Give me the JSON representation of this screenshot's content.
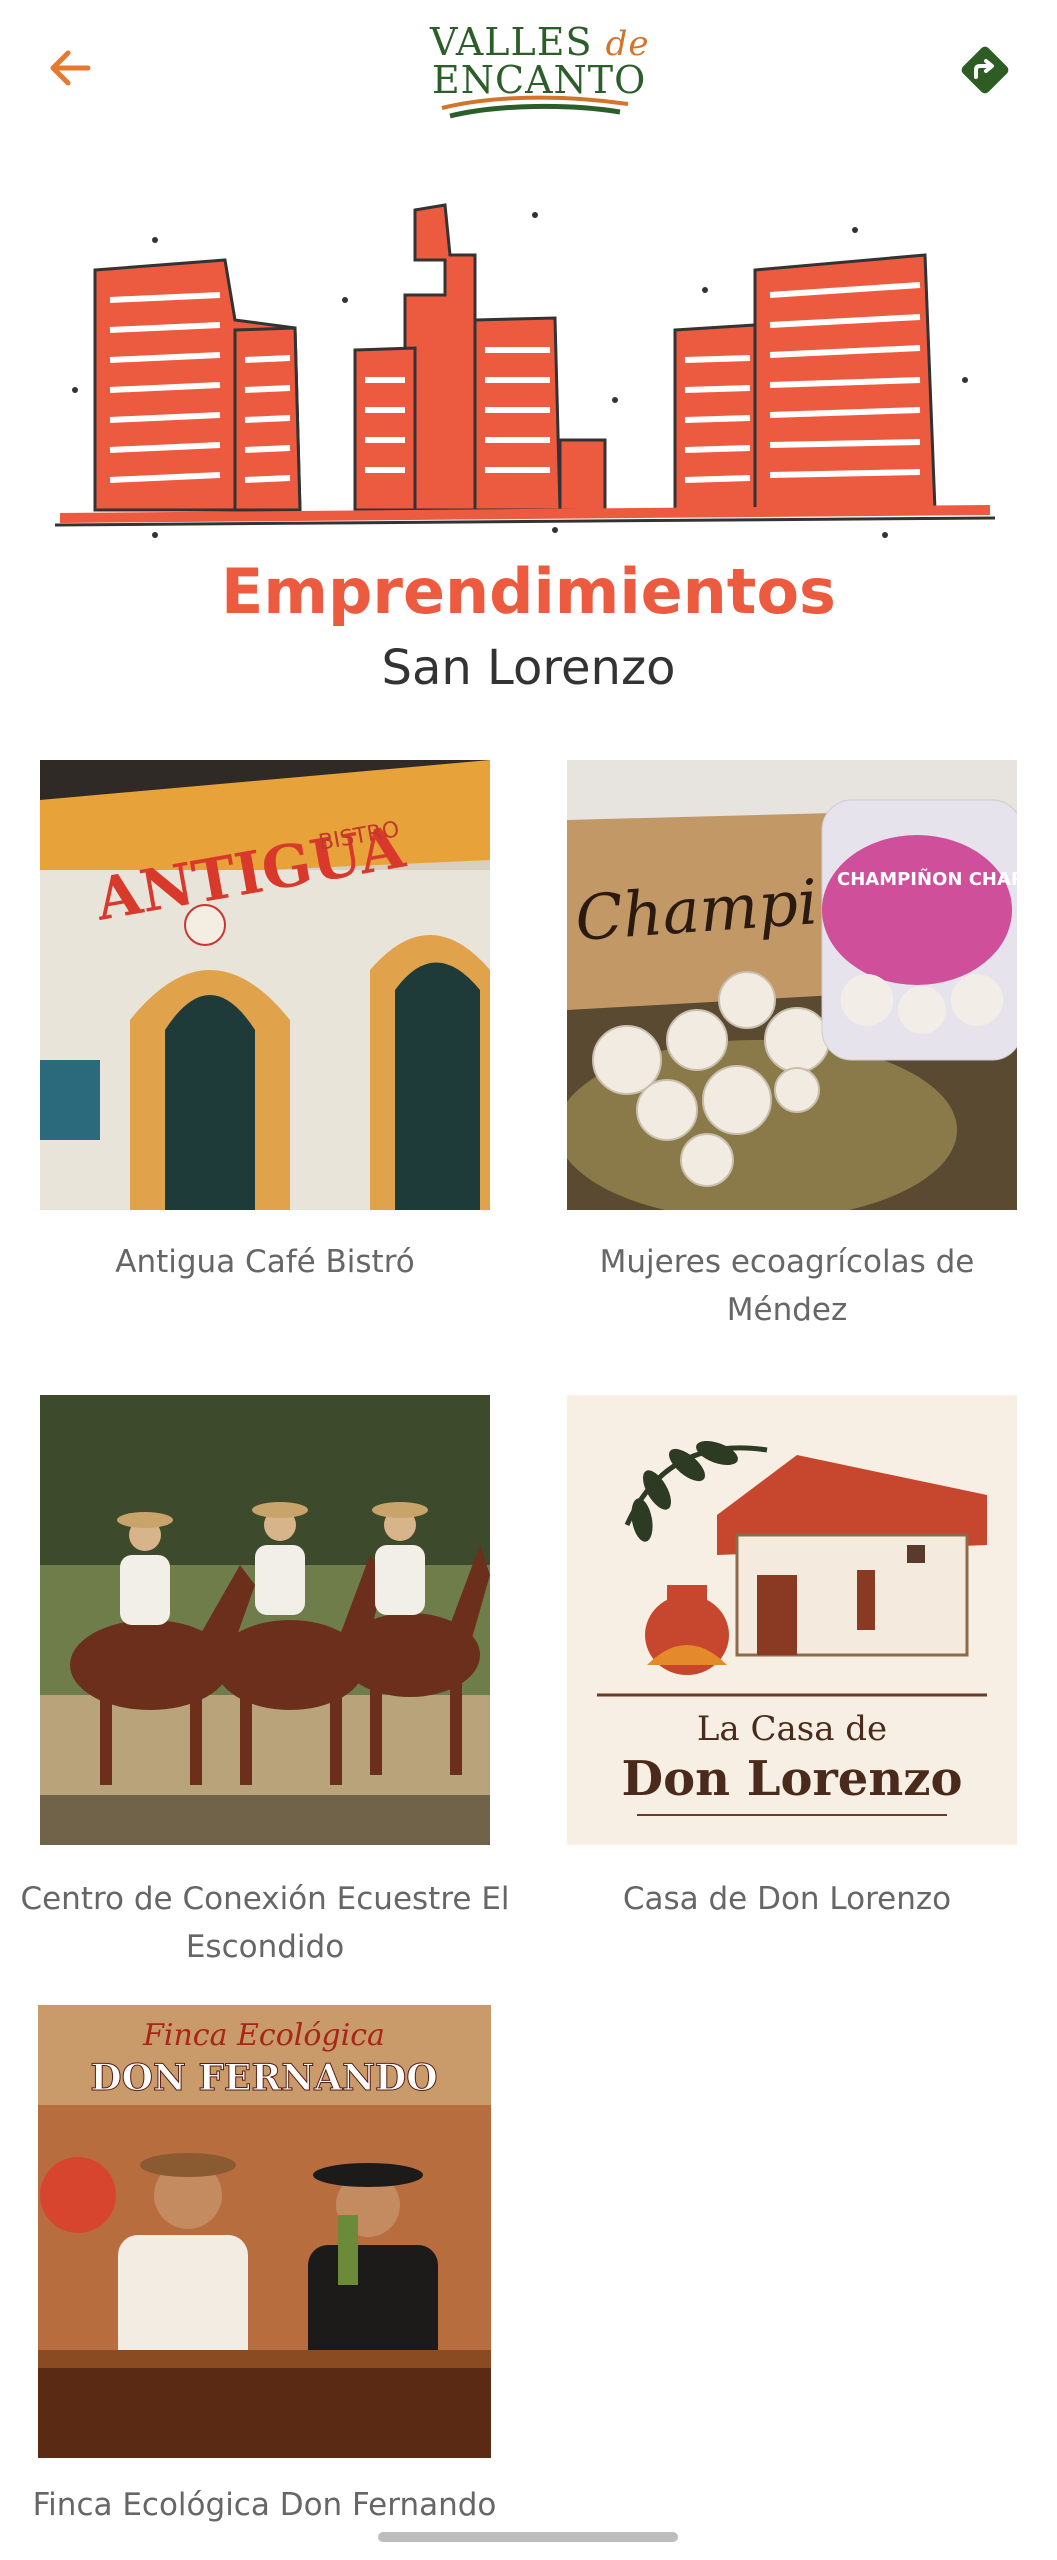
{
  "header": {
    "logo_line1": "VALLES",
    "logo_de": "de",
    "logo_line2": "ENCANTO",
    "back_icon": "arrow-left-icon",
    "share_icon": "share-forward-icon"
  },
  "colors": {
    "accent": "#ec5b3f",
    "back_arrow": "#e8782e",
    "share_bg": "#2e5d23",
    "logo_green": "#2c5e2a"
  },
  "section": {
    "title": "Emprendimientos",
    "subtitle": "San Lorenzo"
  },
  "businesses": [
    {
      "name": "Antigua Café Bistró",
      "sign_text": "ANTIGUA",
      "sign_sub": "BISTRO"
    },
    {
      "name": "Mujeres ecoagrícolas de Méndez",
      "sign_text": "Champiñones",
      "label_text": "CHAMPIÑON CHAPACO"
    },
    {
      "name": "Centro de Conexión Ecuestre El Escondido"
    },
    {
      "name": "Casa de Don Lorenzo",
      "logo_line1": "La Casa de",
      "logo_line2": "Don Lorenzo"
    },
    {
      "name": "Finca Ecológica Don Fernando",
      "banner_line1": "Finca Ecológica",
      "banner_line2": "DON FERNANDO"
    }
  ]
}
